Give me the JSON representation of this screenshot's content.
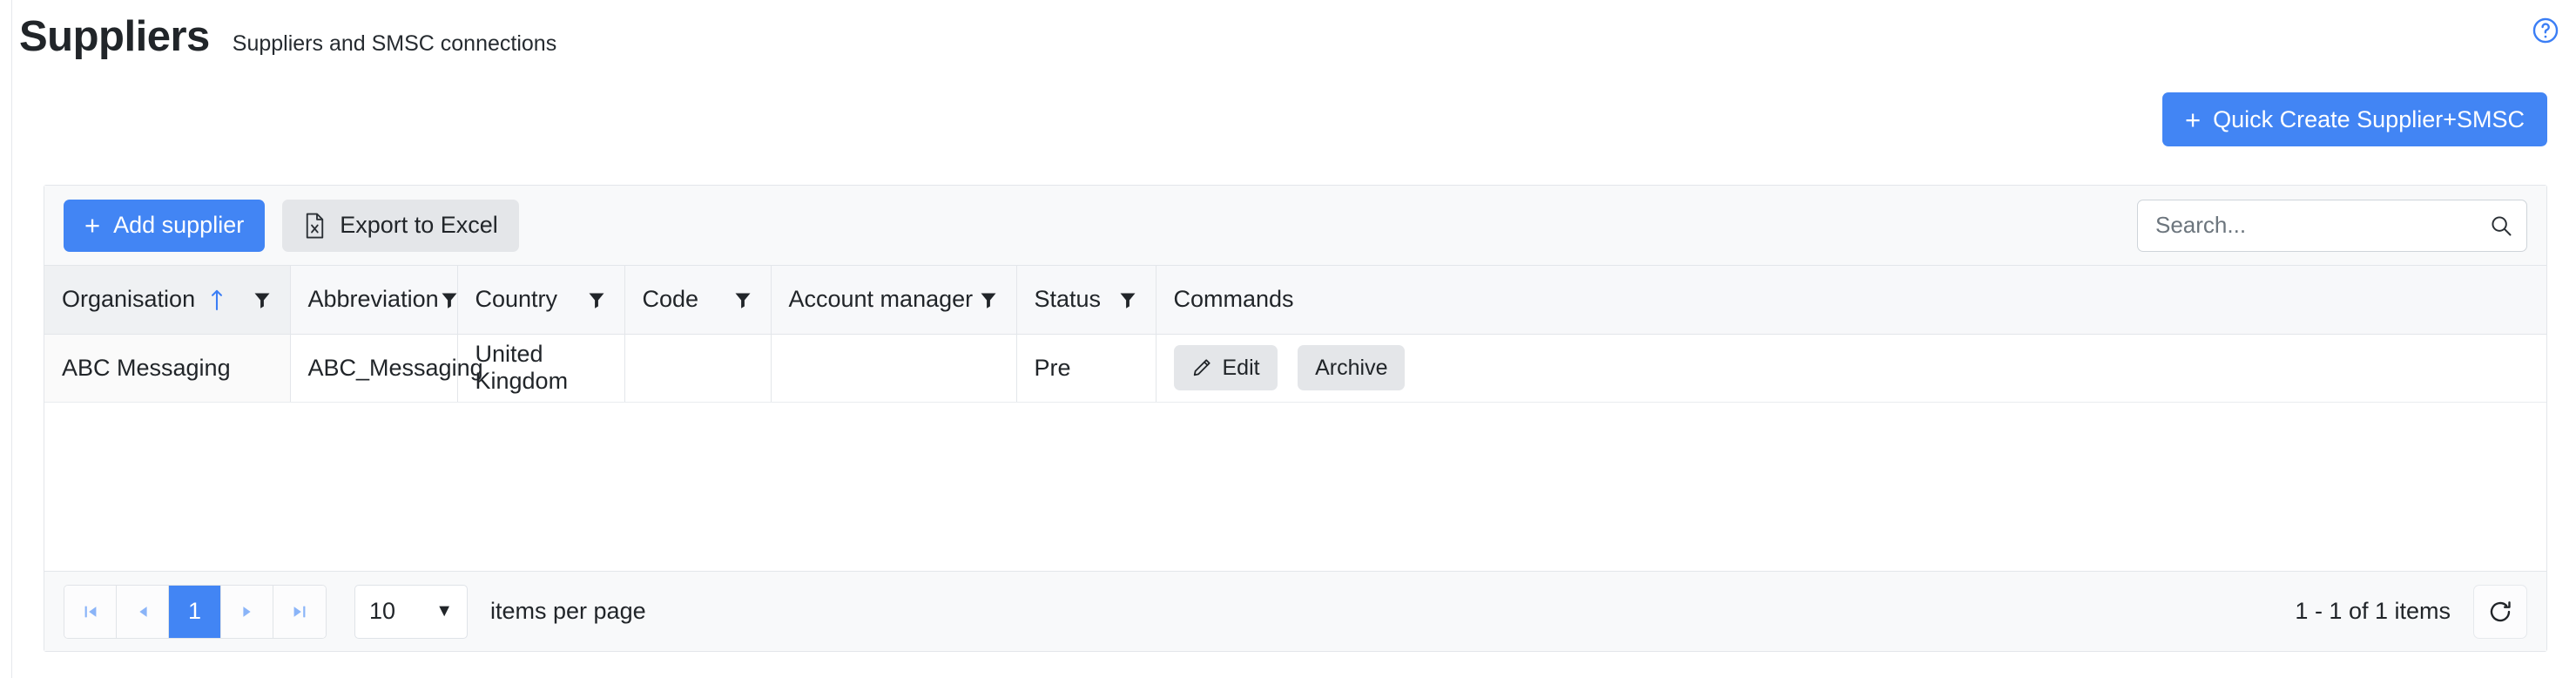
{
  "header": {
    "title": "Suppliers",
    "subtitle": "Suppliers and SMSC connections",
    "help_icon": "help-circle-icon"
  },
  "quick_create": {
    "plus": "+",
    "label": "Quick Create Supplier+SMSC"
  },
  "toolbar": {
    "add_plus": "+",
    "add_label": "Add supplier",
    "export_label": "Export to Excel",
    "export_icon": "excel-file-icon"
  },
  "search": {
    "value": "",
    "placeholder": "Search...",
    "icon": "search-icon"
  },
  "table": {
    "columns": [
      {
        "label": "Organisation",
        "sorted": true,
        "sort_dir": "asc",
        "filter": true
      },
      {
        "label": "Abbreviation",
        "sorted": false,
        "sort_dir": "",
        "filter": true
      },
      {
        "label": "Country",
        "sorted": false,
        "sort_dir": "",
        "filter": true
      },
      {
        "label": "Code",
        "sorted": false,
        "sort_dir": "",
        "filter": true
      },
      {
        "label": "Account manager",
        "sorted": false,
        "sort_dir": "",
        "filter": true
      },
      {
        "label": "Status",
        "sorted": false,
        "sort_dir": "",
        "filter": true
      },
      {
        "label": "Commands",
        "sorted": false,
        "sort_dir": "",
        "filter": false
      }
    ],
    "rows": [
      {
        "organisation": "ABC Messaging",
        "abbreviation": "ABC_Messaging",
        "country": "United Kingdom",
        "code": "",
        "account_manager": "",
        "status": "Pre",
        "edit_label": "Edit",
        "archive_label": "Archive"
      }
    ]
  },
  "pager": {
    "first_icon": "first-page-icon",
    "prev_icon": "prev-page-icon",
    "current_page": "1",
    "next_icon": "next-page-icon",
    "last_icon": "last-page-icon",
    "page_size": "10",
    "page_size_caret": "▼",
    "items_per_page_label": "items per page",
    "range_text": "1 - 1 of 1 items",
    "refresh_icon": "refresh-icon"
  },
  "colors": {
    "accent": "#4285f4",
    "header_bg": "#f7f8fa",
    "sorted_bg": "#eff1f3",
    "button_grey": "#e4e6e9"
  }
}
